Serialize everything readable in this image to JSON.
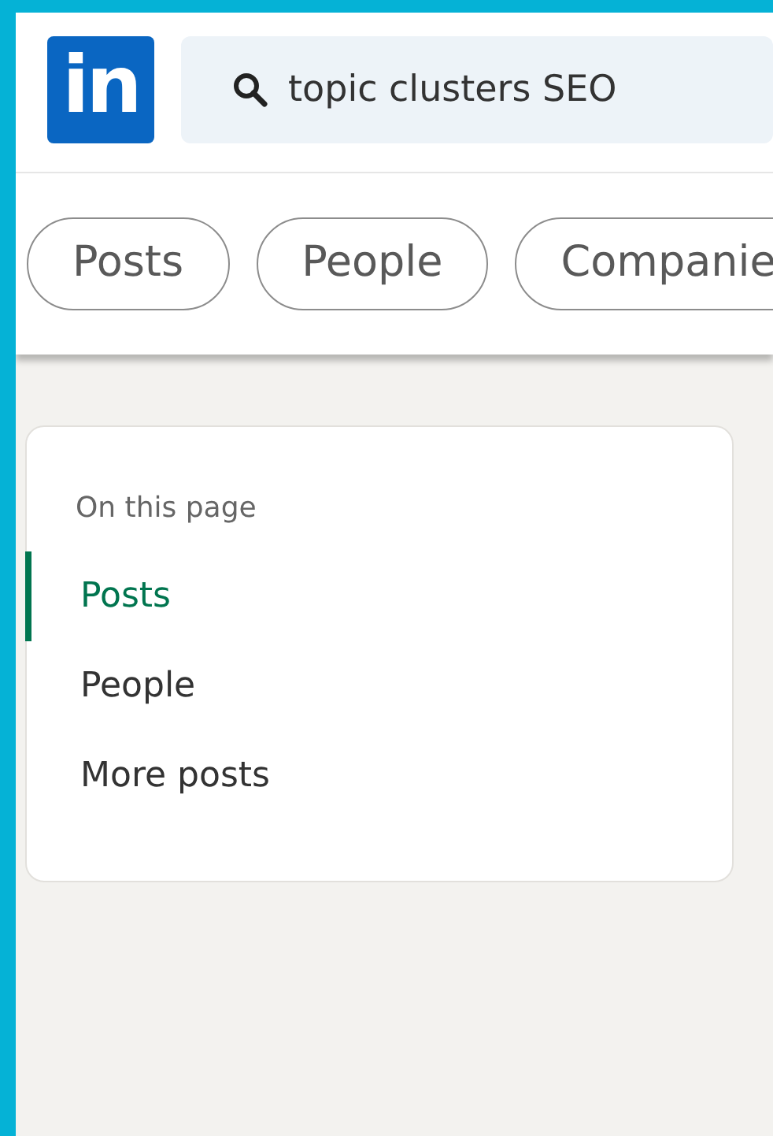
{
  "logo": "in",
  "search": {
    "value": "topic clusters SEO"
  },
  "filters": [
    {
      "label": "Posts",
      "selected": false
    },
    {
      "label": "People",
      "selected": false
    },
    {
      "label": "Companie",
      "selected": false
    }
  ],
  "page_nav": {
    "heading": "On this page",
    "items": [
      {
        "label": "Posts",
        "selected": true
      },
      {
        "label": "People",
        "selected": false
      },
      {
        "label": "More posts",
        "selected": false
      }
    ]
  }
}
